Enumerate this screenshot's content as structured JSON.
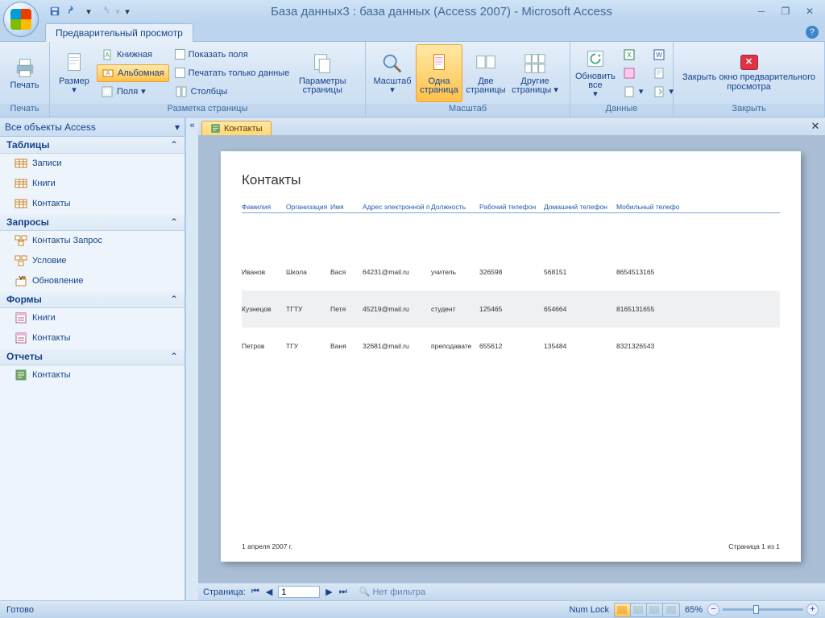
{
  "title": "База данных3 : база данных (Access 2007) - Microsoft Access",
  "tab": "Предварительный просмотр",
  "ribbon": {
    "print": {
      "btn": "Печать",
      "group": "Печать"
    },
    "layout": {
      "size": "Размер",
      "portrait": "Книжная",
      "landscape": "Альбомная",
      "margins": "Поля",
      "showfields": "Показать поля",
      "dataonly": "Печатать только данные",
      "columns": "Столбцы",
      "pagesetup": "Параметры страницы",
      "group": "Разметка страницы"
    },
    "zoom": {
      "zoom": "Масштаб",
      "one": "Одна страница",
      "two": "Две страницы",
      "more": "Другие страницы",
      "group": "Масштаб"
    },
    "data": {
      "refresh": "Обновить все",
      "group": "Данные"
    },
    "close": {
      "btn": "Закрыть окно предварительного просмотра",
      "group": "Закрыть"
    }
  },
  "nav": {
    "title": "Все объекты Access",
    "groups": [
      {
        "name": "Таблицы",
        "items": [
          "Записи",
          "Книги",
          "Контакты"
        ]
      },
      {
        "name": "Запросы",
        "items": [
          "Контакты Запрос",
          "Условие",
          "Обновление"
        ]
      },
      {
        "name": "Формы",
        "items": [
          "Книги",
          "Контакты"
        ]
      },
      {
        "name": "Отчеты",
        "items": [
          "Контакты"
        ]
      }
    ]
  },
  "doc": {
    "tab": "Контакты",
    "title": "Контакты",
    "headers": [
      "Фамилия",
      "Организация",
      "Имя",
      "Адрес электронной п",
      "Должность",
      "Рабочий телефон",
      "Домашний телефон",
      "Мобильный телефо"
    ],
    "rows": [
      [
        "Иванов",
        "Школа",
        "Вася",
        "64231@mail.ru",
        "учитель",
        "326598",
        "568151",
        "8654513165"
      ],
      [
        "Кузнецов",
        "ТГТУ",
        "Петя",
        "45219@mail.ru",
        "студент",
        "125465",
        "654664",
        "8165131655"
      ],
      [
        "Петров",
        "ТГУ",
        "Ваня",
        "32681@mail.ru",
        "преподавате",
        "655612",
        "135484",
        "8321326543"
      ]
    ],
    "footL": "1 апреля 2007 г.",
    "footR": "Страница 1 из 1",
    "pageLabel": "Страница:",
    "pageVal": "1",
    "nofilter": "Нет фильтра"
  },
  "status": {
    "ready": "Готово",
    "numlock": "Num Lock",
    "zoom": "65%"
  }
}
